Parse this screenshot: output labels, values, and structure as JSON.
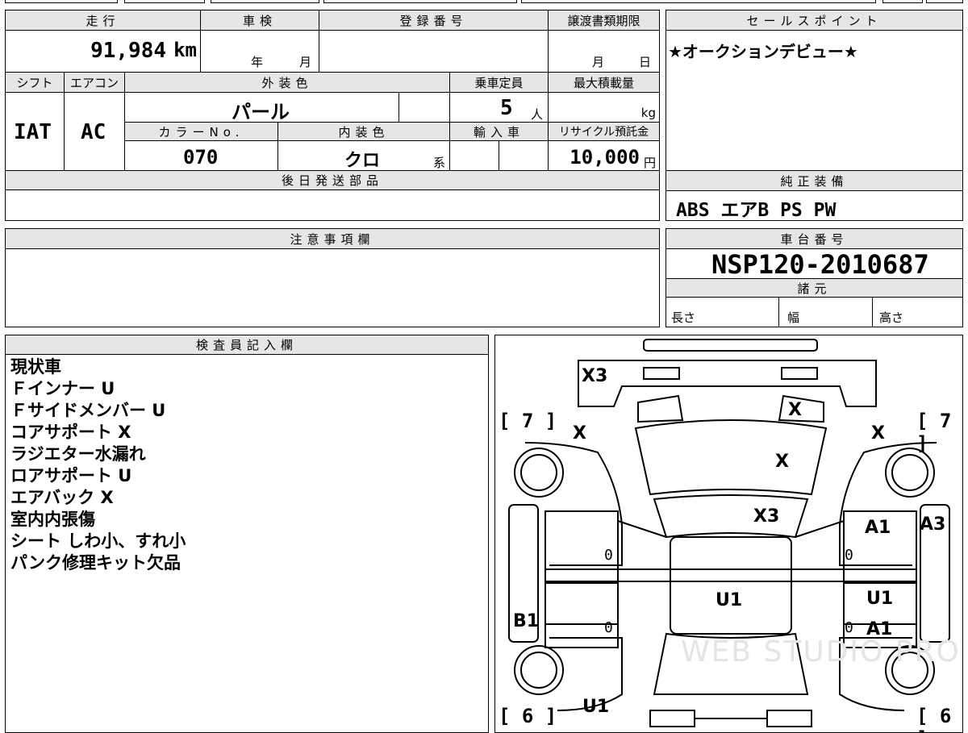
{
  "vehicle": {
    "mileage_label": "走行",
    "mileage_value": "91,984",
    "mileage_unit": "km",
    "shaken_label": "車検",
    "shaken_year": "年",
    "shaken_month": "月",
    "reg_label": "登録番号",
    "transfer_label": "譲渡書類期限",
    "transfer_month": "月",
    "transfer_day": "日",
    "shift_label": "シフト",
    "shift_value": "IAT",
    "ac_label": "エアコン",
    "ac_value": "AC",
    "exterior_label": "外装色",
    "exterior_value": "パール",
    "capacity_label": "乗車定員",
    "capacity_value": "5",
    "capacity_unit": "人",
    "maxload_label": "最大積載量",
    "maxload_unit": "kg",
    "colorno_label": "カラーNo.",
    "colorno_value": "070",
    "interior_label": "内装色",
    "interior_value": "クロ",
    "interior_suffix": "系",
    "import_label": "輸入車",
    "recycle_label": "リサイクル預託金",
    "recycle_value": "10,000",
    "recycle_unit": "円",
    "later_label": "後日発送部品"
  },
  "sales": {
    "label": "セールスポイント",
    "text": "★オークションデビュー★"
  },
  "equipment": {
    "label": "純正装備",
    "items": "ABS  エアB  PS  PW"
  },
  "caution": {
    "label": "注意事項欄"
  },
  "chassis": {
    "label": "車台番号",
    "number": "NSP120-2010687",
    "spec_label": "諸元",
    "length": "長さ",
    "width": "幅",
    "height": "高さ"
  },
  "inspector": {
    "label": "検査員記入欄",
    "lines": [
      "現状車",
      "Ｆインナー U",
      "Ｆサイドメンバー U",
      "コアサポート X",
      "ラジエター水漏れ",
      "ロアサポート U",
      "エアバック X",
      "室内内張傷",
      "シート しわ小、すれ小",
      "パンク修理キット欠品"
    ]
  },
  "diagram": {
    "front_x3": "X3",
    "hood_x": "X",
    "fl_fender": "X",
    "fr_fender": "X",
    "windshield": "X",
    "roof_front": "X3",
    "r_front_door": "A1",
    "r_pillar": "A3",
    "center": "U1",
    "r_rear_door_u": "U1",
    "r_rear_door_a": "A1",
    "l_rocker": "B1",
    "rear_left": "U1",
    "fl_tire": "7",
    "fr_tire": "7",
    "rl_tire": "6",
    "rr_tire": "6",
    "zero": "0",
    "watermark": "WEB STUDIO PRO"
  }
}
